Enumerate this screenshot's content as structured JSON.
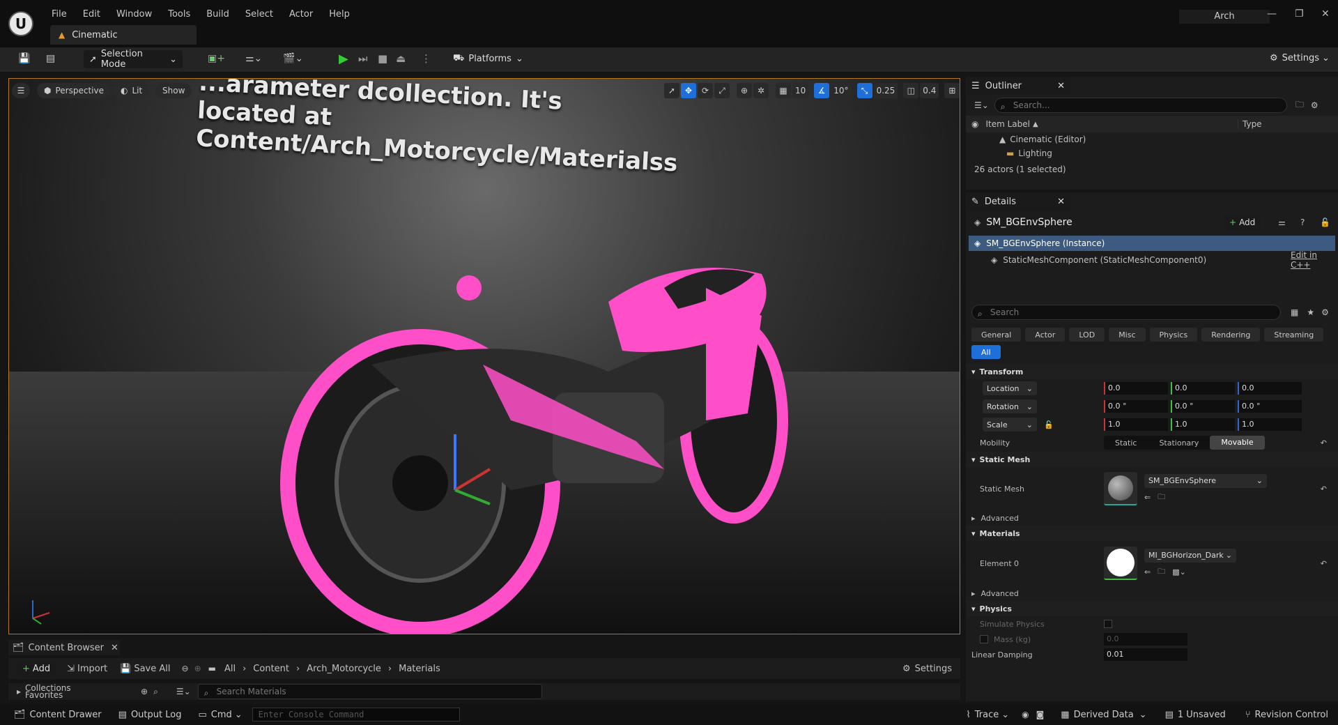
{
  "menu": [
    "File",
    "Edit",
    "Window",
    "Tools",
    "Build",
    "Select",
    "Actor",
    "Help"
  ],
  "document_tab": "Cinematic",
  "project_name": "Arch",
  "toolbar": {
    "mode": "Selection Mode",
    "platforms": "Platforms",
    "settings": "Settings"
  },
  "viewport": {
    "perspective": "Perspective",
    "lit": "Lit",
    "show": "Show",
    "overlay_text": "...arameter dcollection. It's located at Content/Arch_Motorcycle/Materialss",
    "grid_snap": "10",
    "rotation_snap": "10°",
    "scale_snap": "0.25",
    "camera_speed": "0.4"
  },
  "outliner": {
    "tab": "Outliner",
    "search_placeholder": "Search...",
    "col_label": "Item Label",
    "col_type": "Type",
    "rows": [
      "Cinematic (Editor)",
      "Lighting"
    ],
    "status": "26 actors (1 selected)"
  },
  "details": {
    "tab": "Details",
    "actor_name": "SM_BGEnvSphere",
    "add": "Add",
    "instance": "SM_BGEnvSphere (Instance)",
    "component": "StaticMeshComponent (StaticMeshComponent0)",
    "edit_cpp": "Edit in C++",
    "search_placeholder": "Search",
    "filters": [
      "General",
      "Actor",
      "LOD",
      "Misc",
      "Physics",
      "Rendering",
      "Streaming"
    ],
    "filter_all": "All",
    "transform": {
      "header": "Transform",
      "location": {
        "label": "Location",
        "x": "0.0",
        "y": "0.0",
        "z": "0.0"
      },
      "rotation": {
        "label": "Rotation",
        "x": "0.0 °",
        "y": "0.0 °",
        "z": "0.0 °"
      },
      "scale": {
        "label": "Scale",
        "x": "1.0",
        "y": "1.0",
        "z": "1.0"
      },
      "mobility_label": "Mobility",
      "mobility_options": [
        "Static",
        "Stationary",
        "Movable"
      ],
      "mobility_selected": "Movable"
    },
    "static_mesh": {
      "header": "Static Mesh",
      "label": "Static Mesh",
      "value": "SM_BGEnvSphere",
      "advanced": "Advanced"
    },
    "materials": {
      "header": "Materials",
      "label": "Element 0",
      "value": "MI_BGHorizon_Dark",
      "advanced": "Advanced"
    },
    "physics": {
      "header": "Physics",
      "simulate": "Simulate Physics",
      "mass": "Mass (kg)",
      "mass_value": "0.0",
      "damping": "Linear Damping",
      "damping_value": "0.01"
    }
  },
  "content_browser": {
    "tab": "Content Browser",
    "add": "Add",
    "import": "Import",
    "save_all": "Save All",
    "breadcrumb": [
      "All",
      "Content",
      "Arch_Motorcycle",
      "Materials"
    ],
    "settings": "Settings",
    "collections": "Collections",
    "favorites": "Favorites",
    "search_placeholder": "Search Materials"
  },
  "statusbar": {
    "content_drawer": "Content Drawer",
    "output_log": "Output Log",
    "cmd": "Cmd",
    "console_placeholder": "Enter Console Command",
    "trace": "Trace",
    "derived_data": "Derived Data",
    "unsaved": "1 Unsaved",
    "revision_control": "Revision Control"
  }
}
